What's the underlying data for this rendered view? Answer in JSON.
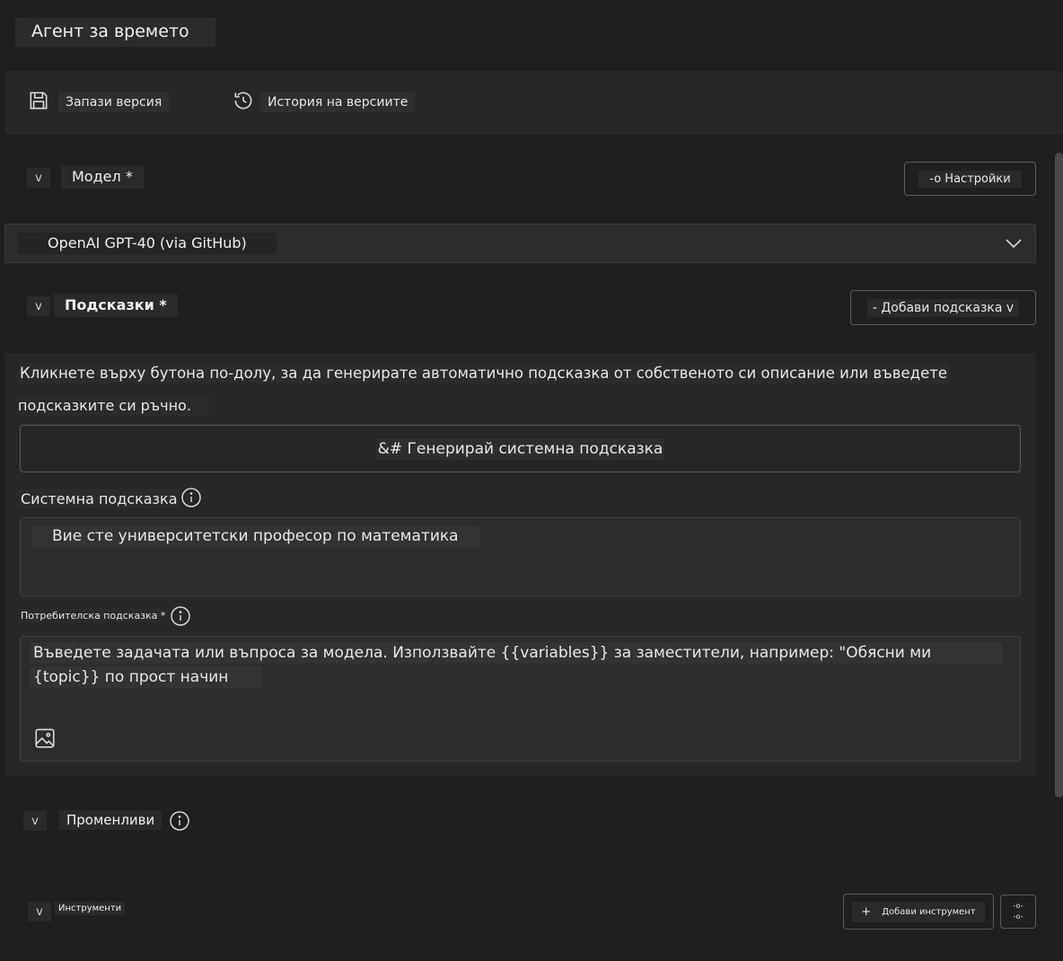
{
  "window": {
    "title": "Агент за времето"
  },
  "toolbar": {
    "save_label": "Запази версия",
    "history_label": "История на версиите"
  },
  "model_section": {
    "label": "Модел *",
    "toggle": "v",
    "settings_label": "-o Настройки",
    "selected_model": "OpenAI GPT-40 (via GitHub)"
  },
  "prompts_section": {
    "label": "Подсказки *",
    "toggle": "v",
    "add_label": "- Добави подсказка v",
    "intro_line1": "Кликнете върху бутона по-долу, за да генерирате автоматично подсказка от собственото си описание или въведете",
    "intro_line2": "подсказките си ръчно.",
    "generate_label": "&# Генерирай системна подсказка",
    "system_label": "Системна подсказка",
    "system_value": "Вие сте университетски професор по математика",
    "user_label": "Потребителска подсказка *",
    "user_placeholder_line1": "Въведете задачата или въпроса за модела. Използвайте {{variables}} за заместители, например: \"Обясни ми",
    "user_placeholder_line2": "{topic}} по прост начин"
  },
  "variables_section": {
    "label": "Променливи",
    "toggle": "v"
  },
  "tools_section": {
    "label": "Инструменти",
    "toggle": "v",
    "add_label": "Добави инструмент",
    "add_icon": "+",
    "more_line1": "-o-",
    "more_line2": "-o-"
  },
  "icons": {
    "save": "save-icon",
    "history": "history-icon",
    "chevron": "chevron-down-icon",
    "info": "info-icon",
    "image": "image-icon"
  },
  "colors": {
    "background": "#1f1f1f",
    "panel": "#272727",
    "field": "#2c2c2c",
    "text": "#e8e8e8",
    "border": "#5a5a5a"
  }
}
